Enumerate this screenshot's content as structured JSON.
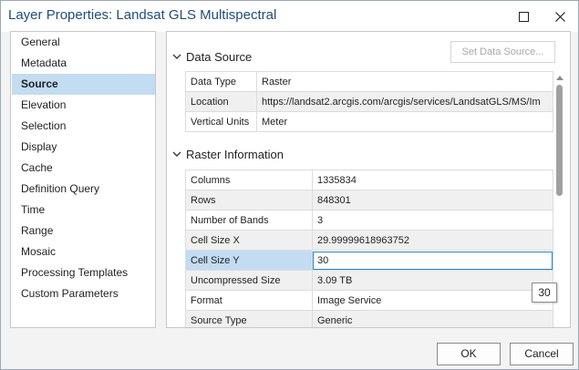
{
  "window": {
    "title": "Layer Properties: Landsat GLS Multispectral"
  },
  "nav": {
    "items": [
      {
        "label": "General"
      },
      {
        "label": "Metadata"
      },
      {
        "label": "Source",
        "selected": true
      },
      {
        "label": "Elevation"
      },
      {
        "label": "Selection"
      },
      {
        "label": "Display"
      },
      {
        "label": "Cache"
      },
      {
        "label": "Definition Query"
      },
      {
        "label": "Time"
      },
      {
        "label": "Range"
      },
      {
        "label": "Mosaic"
      },
      {
        "label": "Processing Templates"
      },
      {
        "label": "Custom Parameters"
      }
    ]
  },
  "data_source": {
    "header": "Data Source",
    "set_button_label": "Set Data Source...",
    "rows": [
      {
        "key": "Data Type",
        "value": "Raster"
      },
      {
        "key": "Location",
        "value": "https://landsat2.arcgis.com/arcgis/services/LandsatGLS/MS/Im"
      },
      {
        "key": "Vertical Units",
        "value": "Meter"
      }
    ]
  },
  "raster_info": {
    "header": "Raster Information",
    "rows": [
      {
        "key": "Columns",
        "value": "1335834"
      },
      {
        "key": "Rows",
        "value": "848301"
      },
      {
        "key": "Number of Bands",
        "value": "3"
      },
      {
        "key": "Cell Size X",
        "value": "29.99999618963752"
      },
      {
        "key": "Cell Size Y",
        "value": "30"
      },
      {
        "key": "Uncompressed Size",
        "value": "3.09 TB"
      },
      {
        "key": "Format",
        "value": "Image Service"
      },
      {
        "key": "Source Type",
        "value": "Generic"
      }
    ]
  },
  "tooltip": {
    "text": "30"
  },
  "buttons": {
    "ok": "OK",
    "cancel": "Cancel"
  },
  "icons": {
    "maximize": "maximize-icon",
    "close": "close-icon",
    "section_toggle": "chevron-down-icon"
  },
  "colors": {
    "title": "#1f4e79",
    "selection": "#c2dcf2",
    "edit_border": "#1e88d4"
  }
}
